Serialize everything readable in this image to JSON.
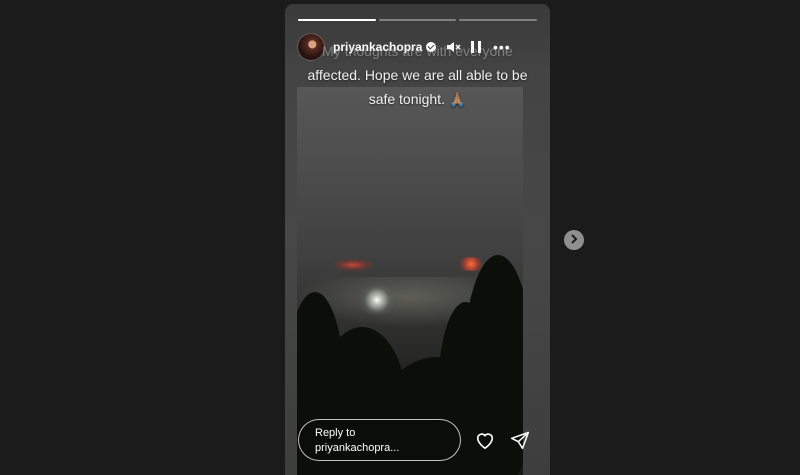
{
  "story": {
    "progress_fraction": [
      1.0,
      0.0,
      0.0
    ],
    "author": {
      "username": "priyankachopra",
      "verified_icon": "verified-badge-icon"
    },
    "controls": {
      "mute_icon": "speaker-muted-icon",
      "pause_icon": "pause-icon",
      "more_icon": "more-horizontal-icon",
      "more_label": "•••"
    },
    "caption": {
      "line1": "My thoughts are with everyone",
      "line2": "affected. Hope we are all able to be",
      "line3": "safe tonight. 🙏🏽"
    },
    "reply": {
      "line1": "Reply to",
      "line2": "priyankachopra..."
    },
    "actions": {
      "like_icon": "heart-icon",
      "share_icon": "send-icon"
    }
  },
  "navigation": {
    "next_icon": "chevron-right-icon"
  },
  "colors": {
    "page_background": "#1b1b1b",
    "text": "#ffffff"
  }
}
